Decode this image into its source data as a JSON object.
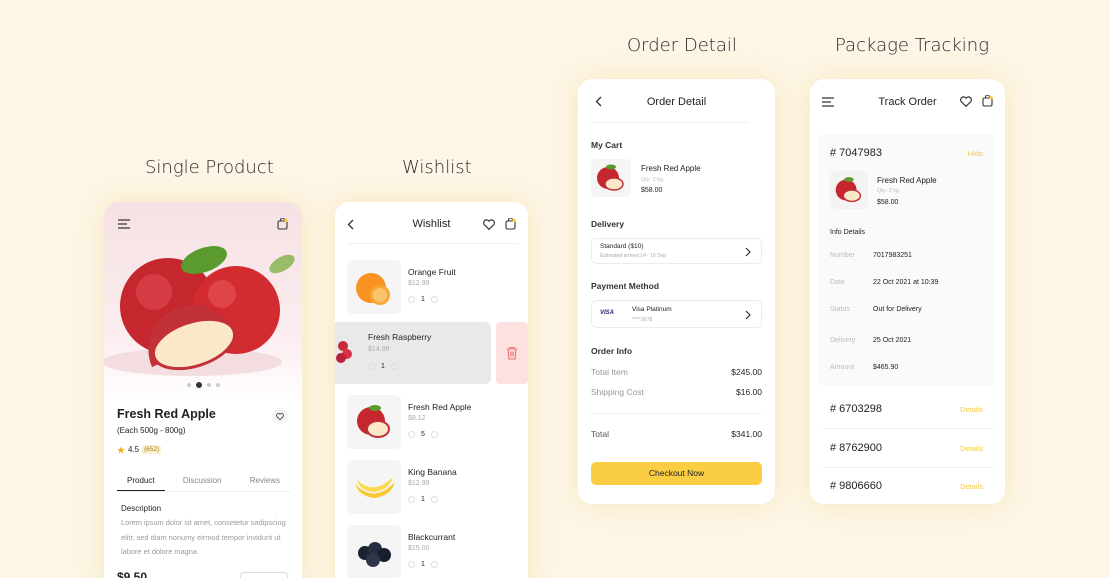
{
  "sections": {
    "single_product": "Single Product",
    "wishlist": "Wishlist",
    "order_detail": "Order Detail",
    "package_tracking": "Package Tracking"
  },
  "colors": {
    "background": "#fdf6e6",
    "accent": "#fbcd43",
    "link": "#f2c94c",
    "delete_bg": "#fde1e1"
  },
  "single_product": {
    "name": "Fresh Red Apple",
    "weight": "(Each 500g - 800g)",
    "rating": "4.5",
    "rating_count": "(652)",
    "tabs": [
      "Product",
      "Discussion",
      "Reviews"
    ],
    "active_tab": "Product",
    "description_title": "Description",
    "description": "Lorem ipsum dolor sit amet, consetetur sadipscing elitr, sed diam nonumy eirmod tempor invidunt ut labore et dolore magna",
    "price": "$9.50",
    "gallery_active_index": 2,
    "icons": {
      "menu": "menu-icon",
      "bag": "shopping-bag-icon",
      "heart": "heart-icon",
      "star": "star-icon"
    }
  },
  "wishlist": {
    "title": "Wishlist",
    "items": [
      {
        "name": "Orange Fruit",
        "price": "$12.99",
        "qty": "1"
      },
      {
        "name": "Fresh Raspberry",
        "price": "$14.99",
        "qty": "1"
      },
      {
        "name": "Fresh Red Apple",
        "price": "$8.12",
        "qty": "5"
      },
      {
        "name": "King Banana",
        "price": "$12.99",
        "qty": "1"
      },
      {
        "name": "Blackcurrant",
        "price": "$15.00",
        "qty": "1"
      }
    ],
    "icons": {
      "back": "chevron-left-icon",
      "heart": "heart-icon",
      "bag": "shopping-bag-icon",
      "delete": "trash-icon"
    }
  },
  "order_detail": {
    "title": "Order Detail",
    "my_cart_label": "My Cart",
    "cart_item": {
      "name": "Fresh Red Apple",
      "qty": "Qty: 2 kg",
      "price": "$58.00"
    },
    "delivery_label": "Delivery",
    "delivery_option": "Standard ($10)",
    "delivery_estimate": "Estimated arrived 14 - 16 Sep",
    "payment_label": "Payment Method",
    "payment_card": "Visa Platinum",
    "payment_card_number": "**** 5678",
    "payment_brand": "VISA",
    "order_info_label": "Order Info",
    "rows": [
      {
        "key": "Total Item",
        "value": "$245.00"
      },
      {
        "key": "Shipping Cost",
        "value": "$16.00"
      }
    ],
    "total_key": "Total",
    "total_value": "$341.00",
    "checkout_label": "Checkout Now"
  },
  "package_tracking": {
    "title": "Track Order",
    "orders": [
      {
        "id": "# 7047983",
        "action": "Hide"
      },
      {
        "id": "# 6703298",
        "action": "Details"
      },
      {
        "id": "# 8762900",
        "action": "Details"
      },
      {
        "id": "# 9806660",
        "action": "Details"
      }
    ],
    "item": {
      "name": "Fresh Red Apple",
      "qty": "Qty: 2 kg",
      "price": "$58.00"
    },
    "info_title": "Info Details",
    "info": [
      {
        "key": "Number",
        "value": "7017983251"
      },
      {
        "key": "Date",
        "value": "22 Oct 2021 at 10:39"
      },
      {
        "key": "Status",
        "value": "Out for Delivery"
      },
      {
        "key": "Delivery",
        "value": "25 Oct 2021"
      },
      {
        "key": "Amount",
        "value": "$465.90"
      }
    ]
  }
}
